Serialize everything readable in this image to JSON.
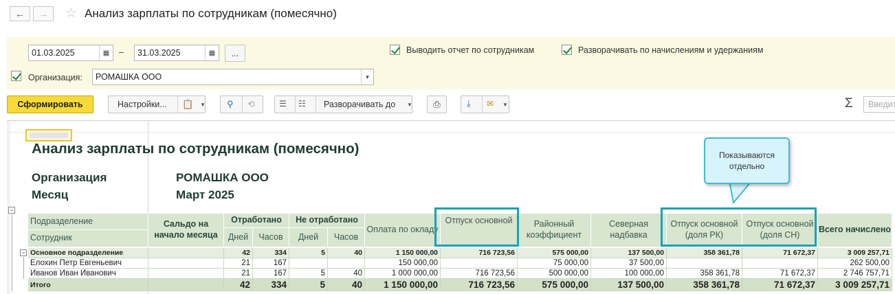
{
  "window": {
    "title": "Анализ зарплаты по сотрудникам (помесячно)",
    "back_icon": "←",
    "forward_icon": "→",
    "star_icon": "☆"
  },
  "params": {
    "date_from": "01.03.2025",
    "date_to": "31.03.2025",
    "dash": "–",
    "period_button": "...",
    "by_employees_label": "Выводить отчет по сотрудникам",
    "expand_accruals_label": "Разворачивать по начислениям и удержаниям",
    "organization_label": "Организация:",
    "organization_value": "РОМАШКА ООО"
  },
  "toolbar": {
    "generate": "Сформировать",
    "settings": "Настройки...",
    "expand_to": "Разворачивать до",
    "sum_icon": "Σ",
    "search_placeholder": "Введите"
  },
  "report": {
    "title": "Анализ зарплаты по сотрудникам (помесячно)",
    "org_label": "Организация",
    "org_value": "РОМАШКА ООО",
    "month_label": "Месяц",
    "month_value": "Март 2025",
    "headers": {
      "department": "Подразделение",
      "employee": "Сотрудник",
      "balance": "Сальдо на начало месяца",
      "worked": "Отработано",
      "not_worked": "Не отработано",
      "days": "Дней",
      "hours": "Часов",
      "salary": "Оплата по окладу",
      "vacation": "Отпуск основной",
      "regional": "Районный коэффициент",
      "northern": "Северная надбавка",
      "vacation_rk": "Отпуск основной (доля РК)",
      "vacation_sn": "Отпуск основной (доля СН)",
      "total": "Всего начислено"
    },
    "rows": [
      {
        "name": "Основное подразделение",
        "balance": "",
        "wd": "42",
        "wh": "334",
        "nd": "5",
        "nh": "40",
        "salary": "1 150 000,00",
        "vac": "716 723,56",
        "rk": "575 000,00",
        "sn": "137 500,00",
        "vrk": "358 361,78",
        "vsn": "71 672,37",
        "total": "3 009 257,71"
      },
      {
        "name": "Елохин Петр Евгеньевич",
        "balance": "",
        "wd": "21",
        "wh": "167",
        "nd": "",
        "nh": "",
        "salary": "150 000,00",
        "vac": "",
        "rk": "75 000,00",
        "sn": "37 500,00",
        "vrk": "",
        "vsn": "",
        "total": "262 500,00"
      },
      {
        "name": "Иванов Иван Иванович",
        "balance": "",
        "wd": "21",
        "wh": "167",
        "nd": "5",
        "nh": "40",
        "salary": "1 000 000,00",
        "vac": "716 723,56",
        "rk": "500 000,00",
        "sn": "100 000,00",
        "vrk": "358 361,78",
        "vsn": "71 672,37",
        "total": "2 746 757,71"
      },
      {
        "name": "Итого",
        "balance": "",
        "wd": "42",
        "wh": "334",
        "nd": "5",
        "nh": "40",
        "salary": "1 150 000,00",
        "vac": "716 723,56",
        "rk": "575 000,00",
        "sn": "137 500,00",
        "vrk": "358 361,78",
        "vsn": "71 672,37",
        "total": "3 009 257,71"
      }
    ]
  },
  "callout": {
    "text": "Показываются отдельно"
  },
  "colors": {
    "accent_highlight": "#17a2b8",
    "primary_button": "#f8d93a",
    "header_bg": "#d8e5cf",
    "params_bg": "#fbf9e1"
  }
}
